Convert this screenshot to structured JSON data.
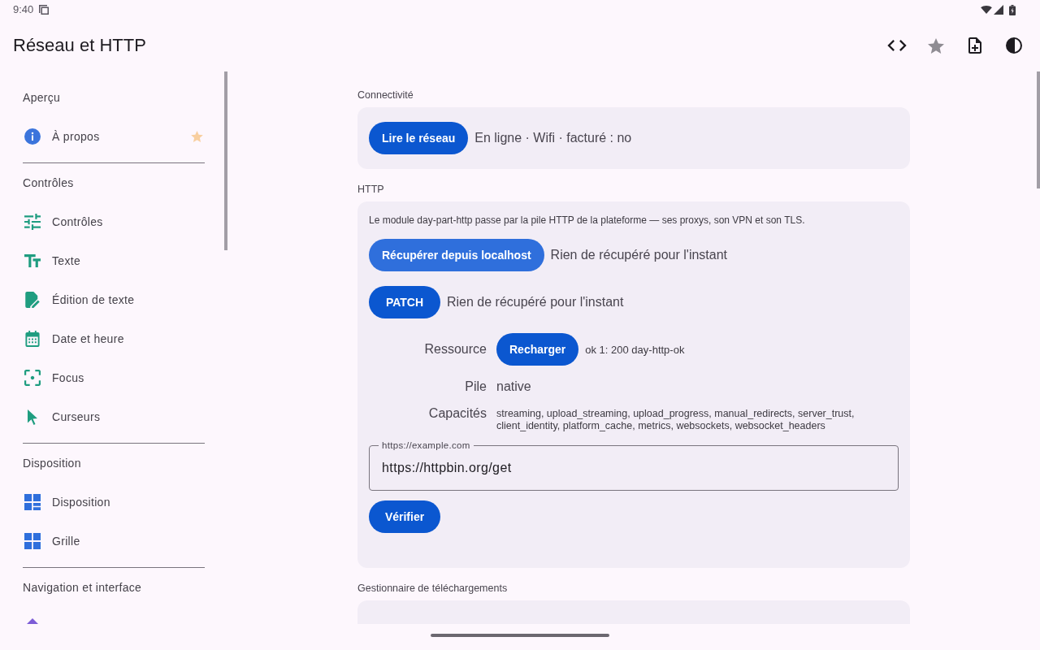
{
  "status_bar": {
    "time": "9:40"
  },
  "app_bar": {
    "title": "Réseau et HTTP"
  },
  "sidebar": {
    "sections": [
      {
        "title": "Aperçu",
        "items": [
          {
            "label": "À propos",
            "selected": false,
            "favorite": true
          }
        ]
      },
      {
        "title": "Contrôles",
        "items": [
          {
            "label": "Contrôles",
            "selected": false,
            "favorite": false
          },
          {
            "label": "Texte",
            "selected": false,
            "favorite": false
          },
          {
            "label": "Édition de texte",
            "selected": false,
            "favorite": false
          },
          {
            "label": "Date et heure",
            "selected": false,
            "favorite": false
          },
          {
            "label": "Focus",
            "selected": false,
            "favorite": false
          },
          {
            "label": "Curseurs",
            "selected": false,
            "favorite": false
          }
        ]
      },
      {
        "title": "Disposition",
        "items": [
          {
            "label": "Disposition",
            "selected": false,
            "favorite": false
          },
          {
            "label": "Grille",
            "selected": false,
            "favorite": false
          }
        ]
      },
      {
        "title": "Navigation et interface",
        "items": [
          {
            "selected": false,
            "favorite": false
          }
        ]
      }
    ]
  },
  "content": {
    "sections": [
      {
        "title": "Connectivité",
        "rows": [
          {
            "kind": "action",
            "button": "Lire le réseau",
            "hovered": false,
            "result": "En ligne · Wifi · facturé : no"
          }
        ]
      },
      {
        "title": "HTTP",
        "rows": [
          {
            "kind": "note",
            "text": "Le module day-part-http passe par la pile HTTP de la plateforme — ses proxys, son VPN et son TLS."
          },
          {
            "kind": "action",
            "button": "Récupérer depuis localhost",
            "hovered": true,
            "result": "Rien de récupéré pour l'instant"
          },
          {
            "kind": "action",
            "button": "PATCH",
            "hovered": false,
            "result": "Rien de récupéré pour l'instant"
          },
          {
            "kind": "property_action",
            "label": "Ressource",
            "button": "Recharger",
            "hovered": false,
            "value": "ok 1: 200 day-http-ok"
          },
          {
            "kind": "property",
            "label": "Pile",
            "value": "native"
          },
          {
            "kind": "property_list",
            "label": "Capacités",
            "value": "streaming, upload_streaming, upload_progress, manual_redirects, server_trust, client_identity, platform_cache, metrics, websockets, websocket_headers"
          },
          {
            "kind": "text_field",
            "label": "https://example.com",
            "value": "https://httpbin.org/get"
          },
          {
            "kind": "button",
            "button": "Vérifier",
            "hovered": false
          }
        ]
      },
      {
        "title": "Gestionnaire de téléchargements"
      }
    ]
  }
}
